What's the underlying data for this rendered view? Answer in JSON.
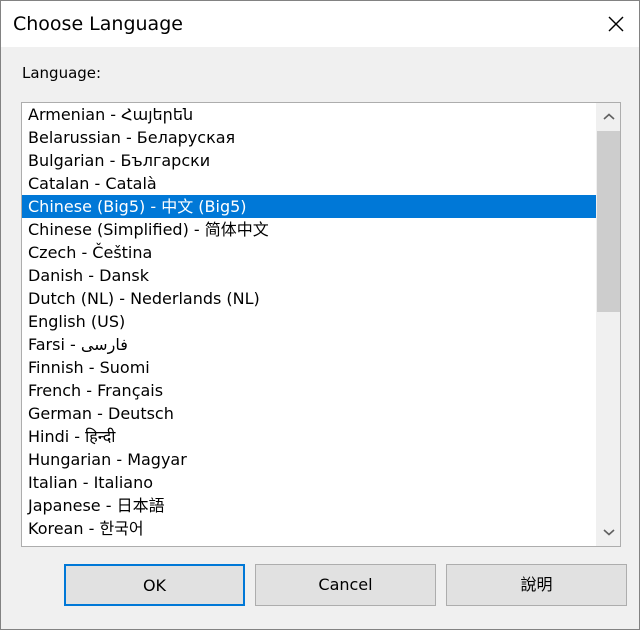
{
  "window": {
    "title": "Choose Language",
    "close_icon": "close-icon",
    "accent_color": "#0078d7",
    "titlebar_color": "#ffffff",
    "body_color": "#f0f0f0",
    "border_color": "#828282"
  },
  "form": {
    "label": "Language:"
  },
  "language_list": {
    "selected_index": 4,
    "scroll": {
      "up_icon": "chevron-up-icon",
      "down_icon": "chevron-down-icon",
      "thumb_color": "#cdcdcd",
      "track_color": "#f0f0f0"
    },
    "items": [
      {
        "label": "Armenian - Հայերեն"
      },
      {
        "label": "Belarussian - Беларуская"
      },
      {
        "label": "Bulgarian - Български"
      },
      {
        "label": "Catalan - Català"
      },
      {
        "label": "Chinese (Big5) - 中文 (Big5)"
      },
      {
        "label": "Chinese (Simplified) - 简体中文"
      },
      {
        "label": "Czech - Čeština"
      },
      {
        "label": "Danish - Dansk"
      },
      {
        "label": "Dutch (NL) - Nederlands (NL)"
      },
      {
        "label": "English (US)"
      },
      {
        "label": "Farsi - فارسی"
      },
      {
        "label": "Finnish - Suomi"
      },
      {
        "label": "French - Français"
      },
      {
        "label": "German - Deutsch"
      },
      {
        "label": "Hindi - हिन्दी"
      },
      {
        "label": "Hungarian - Magyar"
      },
      {
        "label": "Italian - Italiano"
      },
      {
        "label": "Japanese - 日本語"
      },
      {
        "label": "Korean - 한국어"
      }
    ]
  },
  "buttons": {
    "ok": "OK",
    "cancel": "Cancel",
    "help": "說明"
  }
}
